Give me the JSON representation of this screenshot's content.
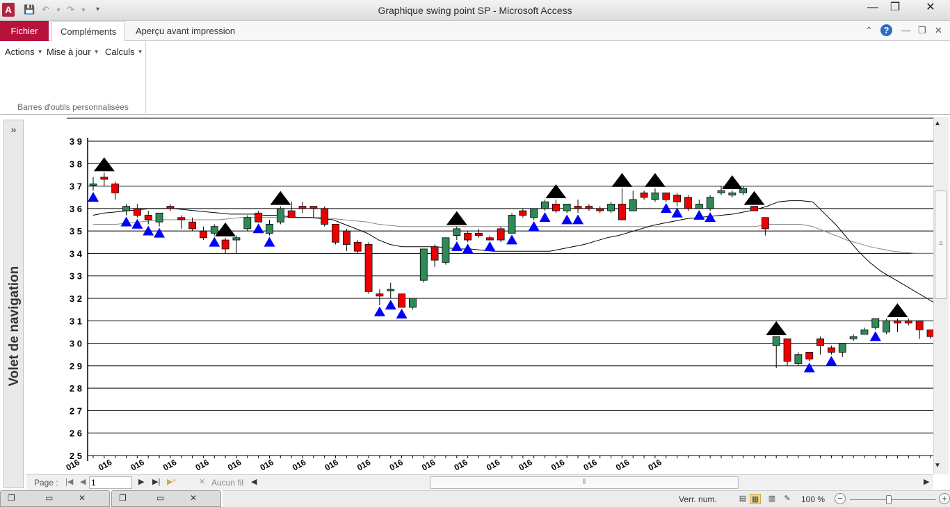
{
  "window": {
    "title": "Graphique swing point SP  -  Microsoft Access",
    "app_icon": "A",
    "controls": {
      "minimize": "—",
      "restore": "❐",
      "close": "✕"
    }
  },
  "qat": {
    "save_icon": "floppy-icon",
    "undo_icon": "undo-icon",
    "redo_icon": "redo-icon",
    "customize_icon": "dropdown-icon"
  },
  "ribbon": {
    "tabs": [
      {
        "label": "Fichier"
      },
      {
        "label": "Compléments"
      },
      {
        "label": "Aperçu avant impression"
      }
    ],
    "menus": [
      {
        "label": "Actions"
      },
      {
        "label": "Mise à jour"
      },
      {
        "label": "Calculs"
      }
    ],
    "group_label": "Barres d'outils personnalisées",
    "right_icons": {
      "minimize_ribbon": "⌃",
      "help": "?",
      "min": "—",
      "restore": "❐",
      "close": "✕"
    }
  },
  "nav_pane": {
    "toggle": "»",
    "label": "Volet de navigation"
  },
  "record_nav": {
    "page_label": "Page :",
    "first": "|◀",
    "prev": "◀",
    "next": "▶",
    "last": "▶|",
    "new": "▶*",
    "page_value": "1",
    "filter": "Aucun fil"
  },
  "status_bar": {
    "text": "Verr. num.",
    "zoom": "100 %",
    "zoom_minus": "−",
    "zoom_plus": "+"
  },
  "colors": {
    "up": "#2e8b57",
    "down": "#ee0000",
    "swing_high": "#000000",
    "swing_low": "#0000ff"
  },
  "chart_data": {
    "type": "candlestick",
    "y_ticks": [
      "3 9",
      "3 8",
      "3 7",
      "3 6",
      "3 5",
      "3 4",
      "3 3",
      "3 2",
      "3 1",
      "3 0",
      "2 9",
      "2 8",
      "2 7",
      "2 6",
      "2 5"
    ],
    "ylim": [
      25,
      39
    ],
    "x_tick_label": "016",
    "x_tick_count": 18,
    "grid": true,
    "candles": [
      {
        "o": 37.1,
        "h": 37.4,
        "l": 36.8,
        "c": 37.1
      },
      {
        "o": 37.4,
        "h": 37.6,
        "l": 37.0,
        "c": 37.3
      },
      {
        "o": 37.1,
        "h": 37.2,
        "l": 36.4,
        "c": 36.7
      },
      {
        "o": 35.9,
        "h": 36.2,
        "l": 35.7,
        "c": 36.1
      },
      {
        "o": 36.0,
        "h": 36.2,
        "l": 35.6,
        "c": 35.7
      },
      {
        "o": 35.7,
        "h": 35.9,
        "l": 35.3,
        "c": 35.5
      },
      {
        "o": 35.4,
        "h": 35.8,
        "l": 35.2,
        "c": 35.8
      },
      {
        "o": 36.1,
        "h": 36.2,
        "l": 35.9,
        "c": 36.0
      },
      {
        "o": 35.6,
        "h": 35.7,
        "l": 35.1,
        "c": 35.5
      },
      {
        "o": 35.4,
        "h": 35.6,
        "l": 35.0,
        "c": 35.1
      },
      {
        "o": 35.0,
        "h": 35.2,
        "l": 34.6,
        "c": 34.7
      },
      {
        "o": 34.9,
        "h": 35.3,
        "l": 34.8,
        "c": 35.2
      },
      {
        "o": 34.6,
        "h": 34.7,
        "l": 34.0,
        "c": 34.2
      },
      {
        "o": 34.6,
        "h": 34.8,
        "l": 34.0,
        "c": 34.7
      },
      {
        "o": 35.1,
        "h": 35.7,
        "l": 35.0,
        "c": 35.6
      },
      {
        "o": 35.8,
        "h": 35.9,
        "l": 35.4,
        "c": 35.4
      },
      {
        "o": 34.9,
        "h": 35.5,
        "l": 34.8,
        "c": 35.3
      },
      {
        "o": 35.4,
        "h": 36.1,
        "l": 35.3,
        "c": 36.0
      },
      {
        "o": 35.9,
        "h": 36.3,
        "l": 35.6,
        "c": 35.6
      },
      {
        "o": 36.1,
        "h": 36.3,
        "l": 35.8,
        "c": 36.0
      },
      {
        "o": 36.1,
        "h": 36.1,
        "l": 35.6,
        "c": 36.0
      },
      {
        "o": 36.0,
        "h": 36.1,
        "l": 35.2,
        "c": 35.3
      },
      {
        "o": 35.3,
        "h": 35.3,
        "l": 34.4,
        "c": 34.5
      },
      {
        "o": 35.0,
        "h": 35.1,
        "l": 34.1,
        "c": 34.4
      },
      {
        "o": 34.5,
        "h": 34.6,
        "l": 34.0,
        "c": 34.1
      },
      {
        "o": 34.4,
        "h": 34.5,
        "l": 32.2,
        "c": 32.3
      },
      {
        "o": 32.2,
        "h": 32.4,
        "l": 31.7,
        "c": 32.1
      },
      {
        "o": 32.4,
        "h": 32.7,
        "l": 32.0,
        "c": 32.4
      },
      {
        "o": 32.2,
        "h": 32.2,
        "l": 31.6,
        "c": 31.6
      },
      {
        "o": 31.6,
        "h": 32.0,
        "l": 31.5,
        "c": 32.0
      },
      {
        "o": 32.8,
        "h": 34.2,
        "l": 32.7,
        "c": 34.2
      },
      {
        "o": 34.3,
        "h": 34.4,
        "l": 33.4,
        "c": 33.7
      },
      {
        "o": 33.6,
        "h": 34.7,
        "l": 33.5,
        "c": 34.7
      },
      {
        "o": 34.8,
        "h": 35.2,
        "l": 34.6,
        "c": 35.1
      },
      {
        "o": 34.9,
        "h": 35.0,
        "l": 34.5,
        "c": 34.6
      },
      {
        "o": 34.9,
        "h": 35.1,
        "l": 34.7,
        "c": 34.8
      },
      {
        "o": 34.7,
        "h": 34.8,
        "l": 34.6,
        "c": 34.6
      },
      {
        "o": 35.1,
        "h": 35.2,
        "l": 34.5,
        "c": 34.6
      },
      {
        "o": 34.9,
        "h": 35.8,
        "l": 34.9,
        "c": 35.7
      },
      {
        "o": 35.9,
        "h": 36.0,
        "l": 35.6,
        "c": 35.7
      },
      {
        "o": 35.6,
        "h": 36.0,
        "l": 35.5,
        "c": 36.0
      },
      {
        "o": 36.0,
        "h": 36.4,
        "l": 35.9,
        "c": 36.3
      },
      {
        "o": 36.2,
        "h": 36.4,
        "l": 35.8,
        "c": 35.9
      },
      {
        "o": 35.9,
        "h": 36.2,
        "l": 35.8,
        "c": 36.2
      },
      {
        "o": 36.1,
        "h": 36.4,
        "l": 35.8,
        "c": 36.0
      },
      {
        "o": 36.1,
        "h": 36.2,
        "l": 35.9,
        "c": 36.0
      },
      {
        "o": 36.0,
        "h": 36.1,
        "l": 35.8,
        "c": 35.9
      },
      {
        "o": 35.9,
        "h": 36.3,
        "l": 35.8,
        "c": 36.2
      },
      {
        "o": 36.2,
        "h": 36.9,
        "l": 35.5,
        "c": 35.5
      },
      {
        "o": 35.9,
        "h": 36.8,
        "l": 35.9,
        "c": 36.4
      },
      {
        "o": 36.7,
        "h": 36.8,
        "l": 36.4,
        "c": 36.5
      },
      {
        "o": 36.4,
        "h": 36.9,
        "l": 36.3,
        "c": 36.7
      },
      {
        "o": 36.7,
        "h": 36.7,
        "l": 36.3,
        "c": 36.4
      },
      {
        "o": 36.6,
        "h": 36.7,
        "l": 36.1,
        "c": 36.3
      },
      {
        "o": 36.5,
        "h": 36.6,
        "l": 35.9,
        "c": 36.0
      },
      {
        "o": 36.0,
        "h": 36.4,
        "l": 36.0,
        "c": 36.2
      },
      {
        "o": 36.0,
        "h": 36.6,
        "l": 35.9,
        "c": 36.5
      },
      {
        "o": 36.7,
        "h": 37.0,
        "l": 36.6,
        "c": 36.8
      },
      {
        "o": 36.6,
        "h": 36.8,
        "l": 36.5,
        "c": 36.7
      },
      {
        "o": 36.7,
        "h": 37.0,
        "l": 36.6,
        "c": 36.9
      },
      {
        "o": 36.1,
        "h": 36.1,
        "l": 35.9,
        "c": 35.9
      },
      {
        "o": 35.6,
        "h": 35.6,
        "l": 34.8,
        "c": 35.1
      },
      {
        "o": 29.9,
        "h": 30.3,
        "l": 28.9,
        "c": 30.3
      },
      {
        "o": 30.2,
        "h": 30.2,
        "l": 29.0,
        "c": 29.2
      },
      {
        "o": 29.1,
        "h": 29.6,
        "l": 29.0,
        "c": 29.5
      },
      {
        "o": 29.6,
        "h": 29.6,
        "l": 29.2,
        "c": 29.3
      },
      {
        "o": 30.2,
        "h": 30.3,
        "l": 29.5,
        "c": 29.9
      },
      {
        "o": 29.8,
        "h": 29.9,
        "l": 29.5,
        "c": 29.6
      },
      {
        "o": 29.6,
        "h": 30.0,
        "l": 29.4,
        "c": 30.0
      },
      {
        "o": 30.2,
        "h": 30.4,
        "l": 30.1,
        "c": 30.3
      },
      {
        "o": 30.4,
        "h": 30.7,
        "l": 30.4,
        "c": 30.6
      },
      {
        "o": 30.7,
        "h": 31.1,
        "l": 30.6,
        "c": 31.1
      },
      {
        "o": 30.5,
        "h": 31.1,
        "l": 30.4,
        "c": 31.0
      },
      {
        "o": 31.0,
        "h": 31.1,
        "l": 30.5,
        "c": 30.9
      },
      {
        "o": 31.0,
        "h": 31.1,
        "l": 30.8,
        "c": 30.9
      },
      {
        "o": 31.0,
        "h": 31.0,
        "l": 30.2,
        "c": 30.6
      },
      {
        "o": 30.6,
        "h": 30.6,
        "l": 30.2,
        "c": 30.3
      }
    ],
    "swing_highs": [
      1,
      12,
      17,
      33,
      42,
      48,
      51,
      58,
      60,
      62,
      73
    ],
    "swing_lows": [
      0,
      3,
      4,
      5,
      6,
      11,
      15,
      16,
      26,
      27,
      28,
      33,
      34,
      36,
      38,
      40,
      41,
      43,
      44,
      52,
      53,
      55,
      56,
      65,
      67,
      71
    ],
    "ma_long": [
      35.3,
      35.3,
      35.3,
      35.35,
      35.4,
      35.45,
      35.5,
      35.5,
      35.5,
      35.5,
      35.5,
      35.5,
      35.55,
      35.6,
      35.6,
      35.6,
      35.6,
      35.6,
      35.6,
      35.6,
      35.6,
      35.55,
      35.5,
      35.45,
      35.4,
      35.3,
      35.25,
      35.2,
      35.2,
      35.2,
      35.2,
      35.2,
      35.2,
      35.2,
      35.2,
      35.2,
      35.2,
      35.2,
      35.2,
      35.2,
      35.2,
      35.2,
      35.2,
      35.2,
      35.2,
      35.2,
      35.2,
      35.2,
      35.2,
      35.2,
      35.2,
      35.2,
      35.2,
      35.2,
      35.2,
      35.2,
      35.2,
      35.2,
      35.2,
      35.3,
      35.3,
      35.3,
      35.3,
      35.2,
      35.0,
      34.8,
      34.6,
      34.45,
      34.3,
      34.2,
      34.1,
      34.05,
      34.0,
      34.0,
      34.0,
      33.95,
      33.95
    ],
    "ma_short": [
      35.7,
      35.8,
      35.85,
      35.9,
      35.95,
      36.0,
      36.0,
      36.0,
      35.95,
      35.9,
      35.85,
      35.8,
      35.75,
      35.75,
      35.75,
      35.7,
      35.7,
      35.65,
      35.6,
      35.6,
      35.55,
      35.5,
      35.3,
      35.1,
      34.9,
      34.6,
      34.4,
      34.3,
      34.3,
      34.3,
      34.3,
      34.25,
      34.2,
      34.2,
      34.15,
      34.1,
      34.1,
      34.1,
      34.1,
      34.1,
      34.1,
      34.2,
      34.3,
      34.4,
      34.55,
      34.7,
      34.8,
      34.95,
      35.1,
      35.25,
      35.35,
      35.45,
      35.55,
      35.6,
      35.65,
      35.7,
      35.75,
      35.85,
      35.95,
      36.1,
      36.3,
      36.35,
      36.35,
      36.3,
      35.8,
      35.3,
      34.7,
      34.1,
      33.6,
      33.2,
      32.9,
      32.6,
      32.3,
      32.0,
      31.7,
      31.4,
      31.2
    ]
  }
}
